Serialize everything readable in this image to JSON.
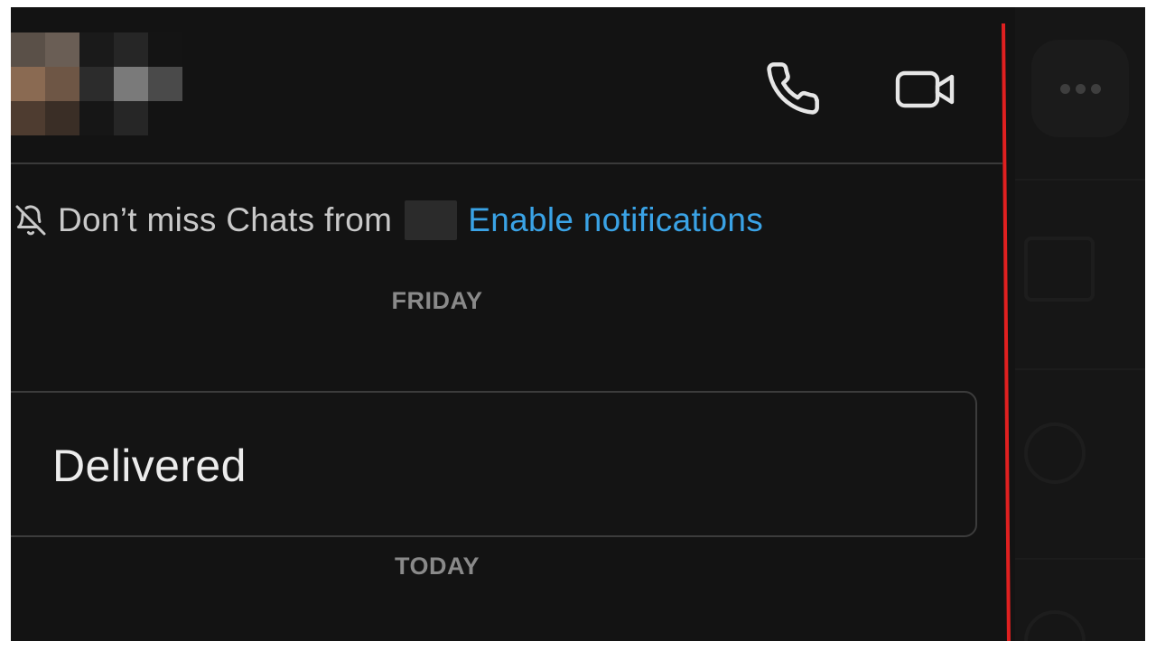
{
  "header": {
    "contact_avatar_icon": "pixelated-avatar",
    "call_icon": "phone-icon",
    "video_icon": "video-camera-icon"
  },
  "notification": {
    "icon": "bell-slash-icon",
    "message": "Don’t miss Chats from",
    "action": "Enable notifications"
  },
  "chat": {
    "day_1": "FRIDAY",
    "message_status": "Delivered",
    "day_2": "TODAY"
  },
  "side_panel": {
    "more_icon": "more-icon"
  },
  "colors": {
    "background": "#131313",
    "link": "#3aa3e6",
    "annotation": "#e02020"
  }
}
